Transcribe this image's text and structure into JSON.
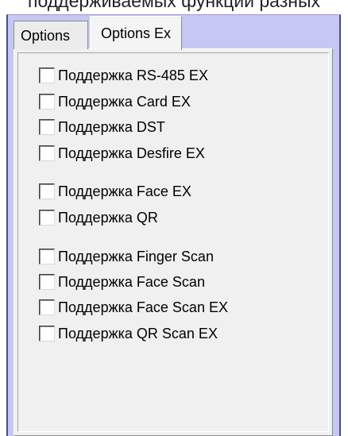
{
  "header": {
    "top_text": "поддерживаемых функций разных"
  },
  "tabs": [
    {
      "label": "Options",
      "active": false
    },
    {
      "label": "Options Ex",
      "active": true
    }
  ],
  "checkboxes": [
    {
      "label": "Поддержка RS-485 EX",
      "checked": false
    },
    {
      "label": "Поддержка Card EX",
      "checked": false
    },
    {
      "label": "Поддержка DST",
      "checked": false
    },
    {
      "label": "Поддержка Desfire EX",
      "checked": false
    },
    {
      "label": "Поддержка Face EX",
      "checked": false
    },
    {
      "label": "Поддержка QR",
      "checked": false
    },
    {
      "label": "Поддержка Finger Scan",
      "checked": false
    },
    {
      "label": "Поддержка Face Scan",
      "checked": false
    },
    {
      "label": "Поддержка Face Scan EX",
      "checked": false
    },
    {
      "label": "Поддержка QR Scan EX",
      "checked": false
    }
  ],
  "colors": {
    "panel_background": "#c5c8f3",
    "panel_border": "#4c4c84",
    "content_background": "#f0f0f0"
  }
}
